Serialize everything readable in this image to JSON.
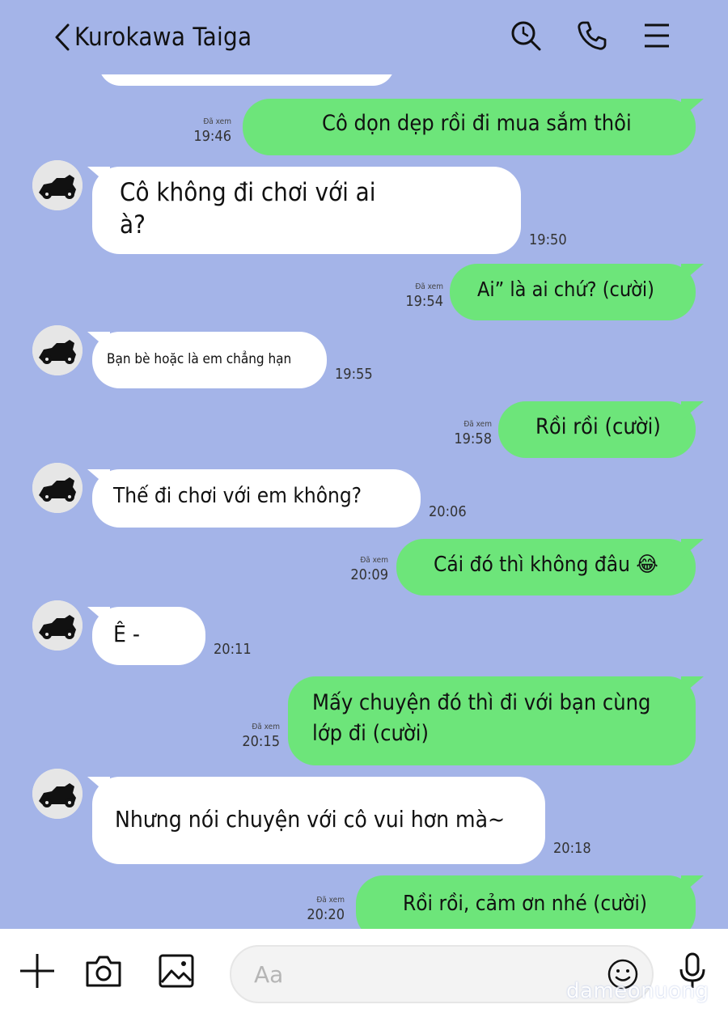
{
  "header": {
    "contact_name": "Kurokawa Taiga",
    "icons": [
      "back-icon",
      "search-icon",
      "phone-icon",
      "menu-icon"
    ]
  },
  "messages": [
    {
      "dir": "out",
      "text": "Cô dọn dẹp rồi đi mua sắm thôi",
      "read": "Đã xem",
      "time": "19:46"
    },
    {
      "dir": "in",
      "text": "Cô không đi chơi với ai\nà?",
      "time": "19:50"
    },
    {
      "dir": "out",
      "text": "Ai” là ai chứ? (cười)",
      "read": "Đã xem",
      "time": "19:54"
    },
    {
      "dir": "in",
      "text": "Bạn bè hoặc là em chẳng hạn",
      "time": "19:55"
    },
    {
      "dir": "out",
      "text": "Rồi rồi (cười)",
      "read": "Đã xem",
      "time": "19:58"
    },
    {
      "dir": "in",
      "text": "Thế đi chơi với em không?",
      "time": "20:06"
    },
    {
      "dir": "out",
      "text": "Cái đó thì không đâu 😂",
      "read": "Đã xem",
      "time": "20:09"
    },
    {
      "dir": "in",
      "text": "Ê -",
      "time": "20:11"
    },
    {
      "dir": "out",
      "text": "Mấy chuyện đó thì đi với bạn cùng\nlớp đi (cười)",
      "read": "Đã xem",
      "time": "20:15"
    },
    {
      "dir": "in",
      "text": "Nhưng nói chuyện với cô vui hơn mà~",
      "time": "20:18"
    },
    {
      "dir": "out",
      "text": "Rồi rồi, cảm ơn nhé (cười)",
      "read": "Đã xem",
      "time": "20:20"
    }
  ],
  "composer": {
    "placeholder": "Aa",
    "icons": [
      "plus-icon",
      "camera-icon",
      "image-icon",
      "emoji-icon",
      "microphone-icon"
    ]
  },
  "watermark": "dameonuong",
  "colors": {
    "background": "#a4b4e8",
    "outgoing_bubble": "#6de57a",
    "incoming_bubble": "#ffffff"
  }
}
